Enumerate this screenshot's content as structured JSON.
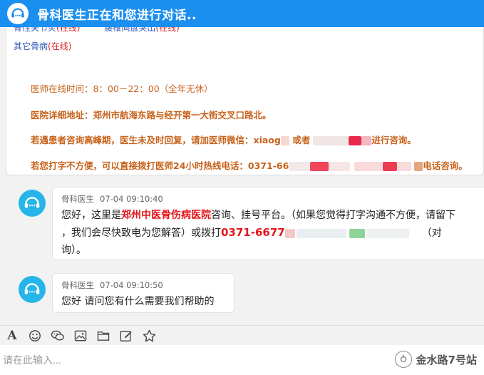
{
  "header": {
    "title": "骨科医生正在和您进行对话..",
    "icon": "headset-icon"
  },
  "intro": {
    "links_row1": [
      {
        "label": "骨性关节炎",
        "status": "(在线)"
      },
      {
        "label": "腰椎间盘突出",
        "status": "(在线)"
      }
    ],
    "links_row2": [
      {
        "label": "其它骨病",
        "status": "(在线)"
      }
    ],
    "online_hours": "医师在线时间：8：00－22：00（全年无休）",
    "address": "医院详细地址：郑州市航海东路与经开第一大街交叉口路北。",
    "wechat_prefix": "若遇患者咨询高峰期，医生未及时回复，请加医师微信：xiaog",
    "wechat_mid": "或者",
    "wechat_suffix": "进行咨询。",
    "hotline_prefix": "若您打字不方便，可以直接拨打医师24小时热线电话：0371-66",
    "hotline_suffix": "电话咨询。"
  },
  "messages": [
    {
      "sender": "骨科医生",
      "time": "07-04 09:10:40",
      "line1_a": "您好，这里是",
      "line1_hospital": "郑州中医骨伤病医院",
      "line1_b": "咨询、挂号平台。（如果您觉得打字沟通不方便，请留下",
      "line2_a": "，我们会尽快致电为您解答）或拨打",
      "line2_phone": "0371-6677",
      "line2_end": "（对",
      "line3": "询）。"
    },
    {
      "sender": "骨科医生",
      "time": "07-04 09:10:50",
      "text": "您好 请问您有什么需要我们帮助的"
    }
  ],
  "toolbar": {
    "font_label": "A",
    "tools": [
      "font-icon",
      "emoji-icon",
      "wechat-icon",
      "image-icon",
      "folder-icon",
      "edit-icon",
      "star-icon"
    ]
  },
  "input": {
    "placeholder": "请在此输入..."
  },
  "watermark": {
    "text": "金水路7号站"
  },
  "colors": {
    "header": "#1a8ff0",
    "avatar": "#25b5e8",
    "info": "#c8621a",
    "link": "#2c55b5",
    "accent_red": "#e4161c"
  }
}
